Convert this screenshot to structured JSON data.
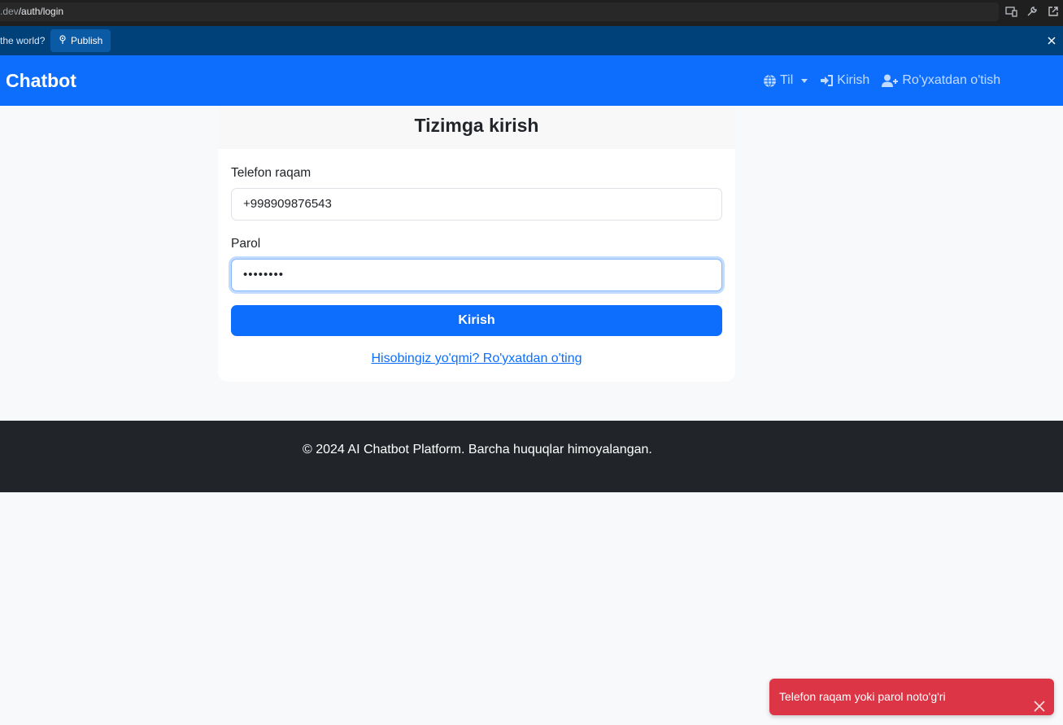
{
  "browser": {
    "url_prefix": ".dev",
    "url_path": "/auth/login"
  },
  "banner": {
    "text": "the world?",
    "publish_label": "Publish"
  },
  "navbar": {
    "brand": "Chatbot",
    "language_label": "Til",
    "login_label": "Kirish",
    "register_label": "Ro'yxatdan o'tish",
    "background_color": "#0d6efd"
  },
  "login_card": {
    "title": "Tizimga kirish",
    "phone_label": "Telefon raqam",
    "phone_value": "+998909876543",
    "password_label": "Parol",
    "password_value": "••••••••",
    "submit_label": "Kirish",
    "register_link": "Hisobingiz yo'qmi? Ro'yxatdan o'ting"
  },
  "footer": {
    "text": "© 2024 AI Chatbot Platform. Barcha huquqlar himoyalangan."
  },
  "toast": {
    "message": "Telefon raqam yoki parol noto'g'ri",
    "color": "#dc3545"
  },
  "icons": [
    "monitor-icon",
    "wrench-icon",
    "external-link-icon",
    "publish-icon",
    "close-icon",
    "globe-icon",
    "login-icon",
    "user-plus-icon"
  ]
}
